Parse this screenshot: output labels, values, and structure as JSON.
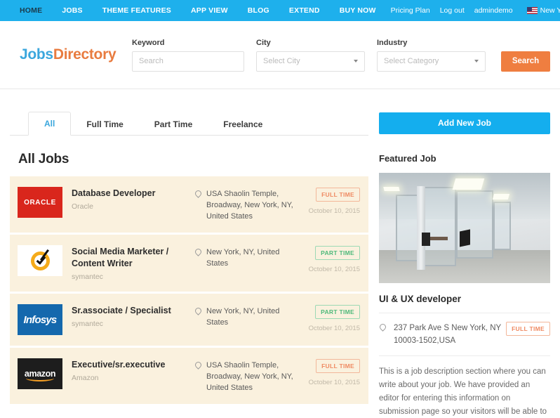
{
  "topnav": {
    "main_items": [
      {
        "label": "HOME",
        "active": true
      },
      {
        "label": "JOBS",
        "active": false
      },
      {
        "label": "THEME FEATURES",
        "active": false
      },
      {
        "label": "APP VIEW",
        "active": false
      },
      {
        "label": "BLOG",
        "active": false
      },
      {
        "label": "EXTEND",
        "active": false
      },
      {
        "label": "BUY NOW",
        "active": false
      }
    ],
    "right_items": [
      {
        "label": "Pricing Plan"
      },
      {
        "label": "Log out"
      },
      {
        "label": "admindemo"
      }
    ],
    "location": "New York",
    "flag_icon": "us-flag-icon",
    "caret_icon": "chevron-down-icon",
    "bg_color": "#1eb0ec"
  },
  "header": {
    "logo_primary": "Jobs",
    "logo_secondary": "Directory",
    "logo_primary_color": "#3ba7dd",
    "logo_secondary_color": "#e87b3f",
    "fields": {
      "keyword": {
        "label": "Keyword",
        "placeholder": "Search",
        "value": ""
      },
      "city": {
        "label": "City",
        "placeholder": "Select City",
        "value": ""
      },
      "industry": {
        "label": "Industry",
        "placeholder": "Select Category",
        "value": ""
      }
    },
    "search_button": "Search",
    "search_button_color": "#ef7e40"
  },
  "tabs": [
    {
      "label": "All",
      "active": true
    },
    {
      "label": "Full Time",
      "active": false
    },
    {
      "label": "Part Time",
      "active": false
    },
    {
      "label": "Freelance",
      "active": false
    }
  ],
  "listing": {
    "title": "All Jobs",
    "jobs": [
      {
        "logo": "oracle-logo",
        "logo_text": "ORACLE",
        "title": "Database Developer",
        "company": "Oracle",
        "location": "USA Shaolin Temple, Broadway, New York, NY, United States",
        "badge": "FULL TIME",
        "badge_type": "full",
        "date": "October 10, 2015"
      },
      {
        "logo": "symantec-logo",
        "logo_text": "",
        "title": "Social Media Marketer / Content Writer",
        "company": "symantec",
        "location": "New York, NY, United States",
        "badge": "PART TIME",
        "badge_type": "part",
        "date": "October 10, 2015"
      },
      {
        "logo": "infosys-logo",
        "logo_text": "Infosys",
        "title": "Sr.associate / Specialist",
        "company": "symantec",
        "location": "New York, NY, United States",
        "badge": "PART TIME",
        "badge_type": "part",
        "date": "October 10, 2015"
      },
      {
        "logo": "amazon-logo",
        "logo_text": "amazon",
        "title": "Executive/sr.executive",
        "company": "Amazon",
        "location": "USA Shaolin Temple, Broadway, New York, NY, United States",
        "badge": "FULL TIME",
        "badge_type": "full",
        "date": "October 10, 2015"
      }
    ]
  },
  "sidebar": {
    "add_job_button": "Add New Job",
    "add_job_color": "#14aeee",
    "featured_heading": "Featured Job",
    "featured": {
      "image_alt": "office-interior-photo",
      "title": "UI & UX developer",
      "address": "237 Park Ave S New York, NY 10003-1502,USA",
      "badge": "FULL TIME",
      "description": "This is a job description section where you can write about your job. We have provided an editor for entering this information on submission page so your visitors will be able to"
    }
  }
}
